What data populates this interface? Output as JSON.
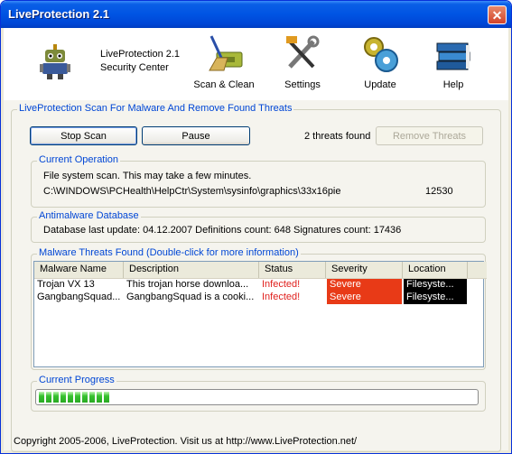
{
  "window": {
    "title": "LiveProtection 2.1"
  },
  "header": {
    "app_name_line1": "LiveProtection 2.1",
    "app_name_line2": "Security Center",
    "toolbar": [
      {
        "label": "Scan & Clean",
        "icon": "broom-icon"
      },
      {
        "label": "Settings",
        "icon": "tools-icon"
      },
      {
        "label": "Update",
        "icon": "gears-icon"
      },
      {
        "label": "Help",
        "icon": "books-icon"
      }
    ]
  },
  "scan_group": {
    "title": "LiveProtection Scan For Malware And Remove Found Threats",
    "stop_label": "Stop Scan",
    "pause_label": "Pause",
    "threat_count": "2 threats found",
    "remove_label": "Remove Threats"
  },
  "current_operation": {
    "title": "Current Operation",
    "line1": "File system scan. This may take a few minutes.",
    "path": "C:\\WINDOWS\\PCHealth\\HelpCtr\\System\\sysinfo\\graphics\\33x16pie",
    "count": "12530"
  },
  "database": {
    "title": "Antimalware Database",
    "info": "Database last update: 04.12.2007 Definitions count: 648 Signatures count: 17436"
  },
  "threats": {
    "title": "Malware Threats Found (Double-click for more information)",
    "columns": [
      "Malware Name",
      "Description",
      "Status",
      "Severity",
      "Location"
    ],
    "rows": [
      {
        "name": "Trojan VX 13",
        "description": "This trojan horse downloa...",
        "status": "Infected!",
        "severity": "Severe",
        "location": "Filesyste..."
      },
      {
        "name": "GangbangSquad...",
        "description": "GangbangSquad is a cooki...",
        "status": "Infected!",
        "severity": "Severe",
        "location": "Filesyste..."
      }
    ]
  },
  "progress": {
    "title": "Current Progress",
    "value_percent": 17
  },
  "footer": {
    "text": "Copyright 2005-2006, LiveProtection. Visit us at http://www.LiveProtection.net/"
  },
  "colors": {
    "title_blue": "#0054e3",
    "group_title": "#0046d5",
    "severe": "#e83a17",
    "infected": "#e0201d",
    "progress_green": "#36c12e"
  }
}
